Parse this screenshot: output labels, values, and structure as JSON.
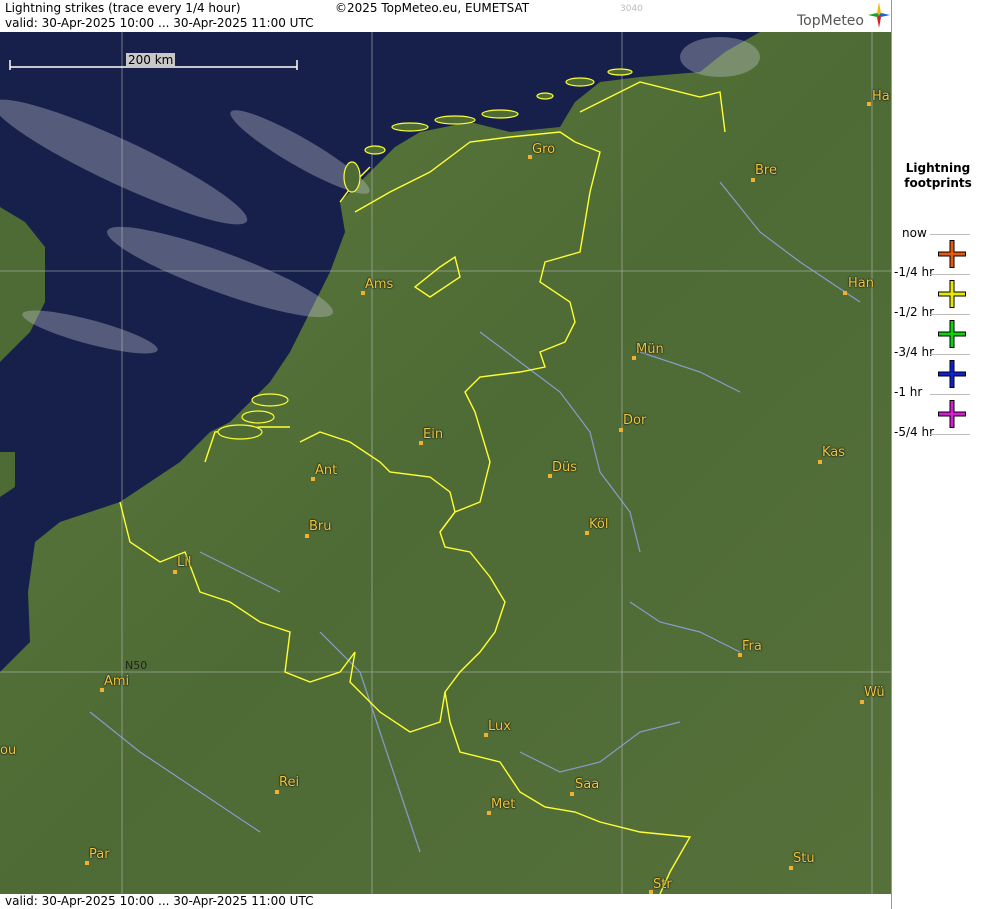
{
  "header": {
    "title": "Lightning strikes (trace every 1/4 hour)",
    "copyright": "©2025 TopMeteo.eu, EUMETSAT",
    "image_id": "3040",
    "valid": "valid:  30-Apr-2025 10:00 ... 30-Apr-2025 11:00 UTC",
    "logo_text": "TopMeteo"
  },
  "footer": {
    "valid": "valid:  30-Apr-2025 10:00 ... 30-Apr-2025 11:00 UTC"
  },
  "map": {
    "scale_label": "200 km",
    "grid_label": "N50",
    "colors": {
      "border": "#ffff33",
      "river": "#8fa6e6",
      "grid": "#c0c0c0",
      "sea": "#16204a",
      "land": "#4f6a35",
      "city": "#f2c640"
    },
    "cities": [
      {
        "name": "Gro"
      },
      {
        "name": "Bre"
      },
      {
        "name": "Ha"
      },
      {
        "name": "Ams"
      },
      {
        "name": "Han"
      },
      {
        "name": "Mün"
      },
      {
        "name": "Dor"
      },
      {
        "name": "Ein"
      },
      {
        "name": "Kas"
      },
      {
        "name": "Ant"
      },
      {
        "name": "Düs"
      },
      {
        "name": "Bru"
      },
      {
        "name": "Köl"
      },
      {
        "name": "Lil"
      },
      {
        "name": "Fra"
      },
      {
        "name": "Ami"
      },
      {
        "name": "Wü"
      },
      {
        "name": "Lux"
      },
      {
        "name": "ou"
      },
      {
        "name": "Rei"
      },
      {
        "name": "Saa"
      },
      {
        "name": "Met"
      },
      {
        "name": "Par"
      },
      {
        "name": "Stu"
      },
      {
        "name": "Str"
      }
    ]
  },
  "legend": {
    "title_line1": "Lightning",
    "title_line2": "footprints",
    "items": [
      {
        "label": "now",
        "color": ""
      },
      {
        "label": "-1/4 hr",
        "color": "#e05a10"
      },
      {
        "label": "-1/2 hr",
        "color": "#e8e800"
      },
      {
        "label": "-3/4 hr",
        "color": "#10d010"
      },
      {
        "label": "-1 hr",
        "color": "#1020d0"
      },
      {
        "label": "-5/4 hr",
        "color": "#d020d0"
      }
    ]
  }
}
